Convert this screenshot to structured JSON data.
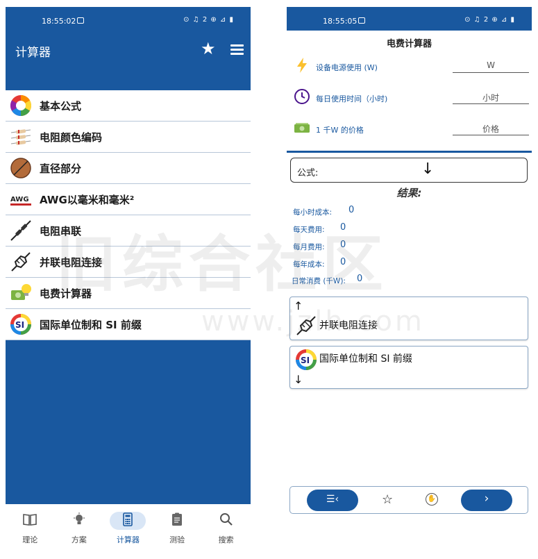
{
  "left": {
    "status_time": "18:55:02",
    "status_icons": "⊙ ♫ 2 ⊕ ⊿ ▮",
    "appbar_title": "计算器",
    "list": [
      {
        "label": "基本公式",
        "icon": "color-wheel-icon"
      },
      {
        "label": "电阻颜色编码",
        "icon": "resistor-color-icon"
      },
      {
        "label": "直径部分",
        "icon": "diameter-icon"
      },
      {
        "label": "AWG以毫米和毫米²",
        "icon": "awg-wire-icon"
      },
      {
        "label": "电阻串联",
        "icon": "series-resistor-icon"
      },
      {
        "label": "并联电阻连接",
        "icon": "parallel-resistor-icon"
      },
      {
        "label": "电费计算器",
        "icon": "money-bulb-icon"
      },
      {
        "label": "国际单位制和 SI 前缀",
        "icon": "si-prefix-icon"
      }
    ],
    "nav": [
      {
        "label": "理论",
        "icon": "book-icon",
        "active": false
      },
      {
        "label": "方案",
        "icon": "bulb-icon",
        "active": false
      },
      {
        "label": "计算器",
        "icon": "calculator-icon",
        "active": true
      },
      {
        "label": "测验",
        "icon": "quiz-clipboard-icon",
        "active": false
      },
      {
        "label": "搜索",
        "icon": "search-icon",
        "active": false
      }
    ]
  },
  "right": {
    "status_time": "18:55:05",
    "status_icons": "⊙ ♫ 2 ⊕ ⊿ ▮",
    "title": "电费计算器",
    "fields": [
      {
        "label": "设备电源使用 (W)",
        "value": "W",
        "icon": "lightning-icon"
      },
      {
        "label": "每日使用时间（小时)",
        "value": "小时",
        "icon": "clock-icon"
      },
      {
        "label": "1 千W 的价格",
        "value": "价格",
        "icon": "money-icon"
      }
    ],
    "formula_label": "公式:",
    "result_title": "结果:",
    "results": [
      {
        "label": "每小时成本:",
        "value": "0"
      },
      {
        "label": "每天费用:",
        "value": "0"
      },
      {
        "label": "每月费用:",
        "value": "0"
      },
      {
        "label": "每年成本:",
        "value": "0"
      },
      {
        "label": "日常消费 (千W):",
        "value": "0"
      }
    ],
    "prev_card_label": "并联电阻连接",
    "next_card_label": "国际单位制和 SI 前缀"
  },
  "watermark": {
    "text": "旧综合社区",
    "url": "www.jzlh.com"
  }
}
